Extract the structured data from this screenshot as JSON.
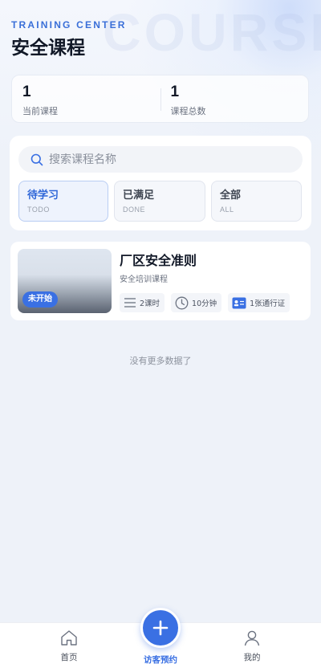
{
  "header": {
    "kicker": "TRAINING CENTER",
    "title": "安全课程",
    "watermark": "COURSE"
  },
  "stats": [
    {
      "value": "1",
      "label": "当前课程"
    },
    {
      "value": "1",
      "label": "课程总数"
    }
  ],
  "search": {
    "placeholder": "搜索课程名称",
    "value": ""
  },
  "tabs": [
    {
      "label": "待学习",
      "sub": "TODO",
      "active": true
    },
    {
      "label": "已满足",
      "sub": "DONE",
      "active": false
    },
    {
      "label": "全部",
      "sub": "ALL",
      "active": false
    }
  ],
  "courses": [
    {
      "badge": "未开始",
      "title": "厂区安全准则",
      "category": "安全培训课程",
      "lessons": "2课时",
      "duration": "10分钟",
      "pass": "1张通行证"
    }
  ],
  "list_footer": "没有更多数据了",
  "tabbar": {
    "home": "首页",
    "visitor": "访客预约",
    "mine": "我的"
  },
  "colors": {
    "accent": "#3a70e3",
    "background": "#eef2f9"
  }
}
